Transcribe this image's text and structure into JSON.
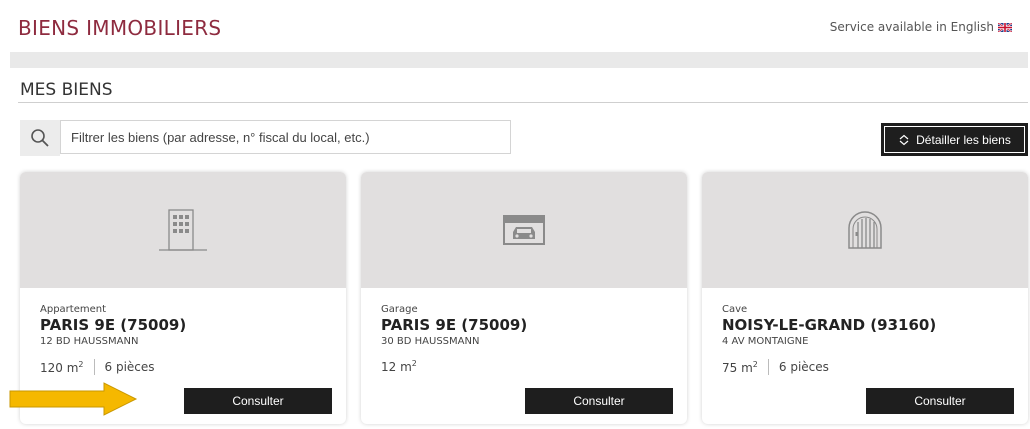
{
  "colors": {
    "brand": "#8e2b3f",
    "button_bg": "#1e1e1e",
    "arrow": "#f5b800"
  },
  "header": {
    "title": "BIENS IMMOBILIERS",
    "lang_link": "Service available in English",
    "lang_flag_icon": "uk-flag-icon"
  },
  "section": {
    "title": "MES BIENS"
  },
  "search": {
    "icon": "search-icon",
    "placeholder": "Filtrer les biens (par adresse, n° fiscal du local, etc.)",
    "value": ""
  },
  "detail_button": {
    "icon": "chevron-up-down-icon",
    "label": "Détailler les biens"
  },
  "cards": [
    {
      "icon": "building-icon",
      "type": "Appartement",
      "city": "PARIS 9E (75009)",
      "address": "12 BD HAUSSMANN",
      "area": "120 m",
      "area_unit_sup": "2",
      "rooms": "6 pièces",
      "button": "Consulter"
    },
    {
      "icon": "garage-car-icon",
      "type": "Garage",
      "city": "PARIS 9E (75009)",
      "address": "30 BD HAUSSMANN",
      "area": "12 m",
      "area_unit_sup": "2",
      "rooms": "",
      "button": "Consulter"
    },
    {
      "icon": "cellar-door-icon",
      "type": "Cave",
      "city": "NOISY-LE-GRAND (93160)",
      "address": "4 AV MONTAIGNE",
      "area": "75 m",
      "area_unit_sup": "2",
      "rooms": "6 pièces",
      "button": "Consulter"
    }
  ],
  "annotation": {
    "icon": "yellow-arrow-icon"
  }
}
